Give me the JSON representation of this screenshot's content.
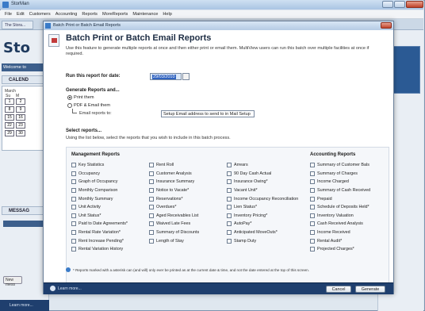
{
  "app": {
    "title": "StorMan",
    "menu": [
      "File",
      "Edit",
      "Customers",
      "Accounting",
      "Reports",
      "MoreReports",
      "Maintenance",
      "Help"
    ],
    "tab_inactive": "The Stora...",
    "logo": "Sto",
    "welcome": "Welcome to",
    "calendar_heading": "CALEND",
    "calendar_month": "March",
    "calendar_days": [
      "Su",
      "M"
    ],
    "calendar_dates": [
      "1",
      "2",
      "8",
      "9",
      "15",
      "16",
      "22",
      "23",
      "29",
      "30"
    ],
    "messages_heading": "MESSAG",
    "new_button": "New mess",
    "taskbar_learn": "Learn more..."
  },
  "dialog": {
    "title": "Batch Print or Batch Email Reports",
    "heading": "Batch Print or Batch Email Reports",
    "description": "Use this feature to generate multiple reports at once and then either print or email them. MultiView users can run this batch over multiple facilities at once if required.",
    "date_label": "Run this report for date:",
    "date_value": "29/03/2010",
    "generate_label": "Generate Reports and...",
    "print_option": "Print them",
    "pdf_option": "PDF & Email them",
    "email_to_label": "Email reports to:",
    "email_value": "Setup Email address to send to in Mail Setup",
    "select_label": "Select reports...",
    "select_desc": "Using the list below, select the reports that you wish to include in this batch process.",
    "footnote": "* Reports marked with a asterisk can (and will) only ever be printed as at the current date & time, and not the date entered at the top of this screen.",
    "learn_more": "Learn more...",
    "cancel_label": "Cancel",
    "generate_button_label": "Generate"
  },
  "reports": {
    "management_heading": "Management Reports",
    "accounting_heading": "Accounting Reports",
    "col1": [
      "Key Statistics",
      "Occupancy",
      "Graph of Occupancy",
      "Monthly Comparison",
      "Monthly Summary",
      "Unit Activity",
      "Unit Status*",
      "Paid to Date Agreements*",
      "Rental Rate Variation*",
      "Rent Increase Pending*",
      "Rental Variation History"
    ],
    "col2": [
      "Rent Roll",
      "Customer Analysis",
      "Insurance Summary",
      "Notice to Vacate*",
      "Reservations*",
      "Overdues*",
      "Aged Receivables List",
      "Waived Late Fees",
      "Summary of Discounts",
      "Length of Stay"
    ],
    "col3": [
      "Arrears",
      "90 Day Cash Actual",
      "Insurance Owing*",
      "Vacant Unit*",
      "Income Occupancy Reconciliation",
      "Lien Status*",
      "Inventory Pricing*",
      "AutoPay*",
      "Anticipated MoveOuts*",
      "Stamp Duty"
    ],
    "col4": [
      "Summary of Customer Bals",
      "Summary of Charges",
      "Income Charged",
      "Summary of Cash Received",
      "Prepaid",
      "Schedule of Deposits Held*",
      "Inventory Valuation",
      "Cash Received Analysis",
      "Income Received",
      "Rental Audit*",
      "Projected Charges*"
    ]
  }
}
